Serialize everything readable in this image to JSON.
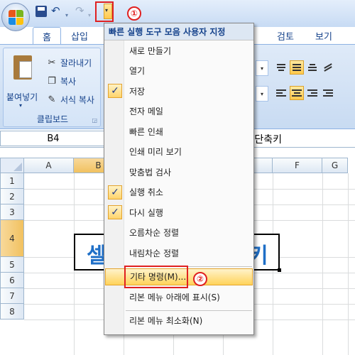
{
  "qat": {
    "customize_caret": "▾",
    "undo_glyph": "↶",
    "redo_glyph": "↷",
    "dropdown_glyph": "▾"
  },
  "callouts": {
    "first": "①",
    "second": "②"
  },
  "tabs": {
    "home": "홈",
    "insert": "삽입",
    "review": "검토",
    "view": "보기"
  },
  "clipboard": {
    "paste": "붙여넣기",
    "paste_caret": "▾",
    "cut": "잘라내기",
    "copy": "복사",
    "format_painter": "서식 복사",
    "group_label": "클립보드",
    "launcher": "◲"
  },
  "formula_bar": {
    "name_box": "B4",
    "visible_text": "l 단축키"
  },
  "grid": {
    "columns": [
      "A",
      "B",
      "C",
      "D",
      "E",
      "F",
      "G"
    ],
    "rows": [
      "1",
      "2",
      "3",
      "4",
      "5",
      "6",
      "7",
      "8"
    ],
    "selected_column": "B",
    "selected_row": "4",
    "cell_left_text": "셀",
    "cell_right_text": "키"
  },
  "menu": {
    "header": "빠른 실행 도구 모음 사용자 지정",
    "items": [
      {
        "label": "새로 만들기",
        "checked": false
      },
      {
        "label": "열기",
        "checked": false
      },
      {
        "label": "저장",
        "checked": true
      },
      {
        "label": "전자 메일",
        "checked": false
      },
      {
        "label": "빠른 인쇄",
        "checked": false
      },
      {
        "label": "인쇄 미리 보기",
        "checked": false
      },
      {
        "label": "맞춤법 검사",
        "checked": false
      },
      {
        "label": "실행 취소",
        "checked": true
      },
      {
        "label": "다시 실행",
        "checked": true
      },
      {
        "label": "오름차순 정렬",
        "checked": false
      },
      {
        "label": "내림차순 정렬",
        "checked": false
      },
      {
        "label": "기타 명령(M)...",
        "checked": false
      },
      {
        "label": "리본 메뉴 아래에 표시(S)",
        "checked": false
      },
      {
        "label": "리본 메뉴 최소화(N)",
        "checked": false
      }
    ],
    "check_glyph": "✓"
  },
  "colors": {
    "accent": "#15428b",
    "highlight": "#e02020",
    "hover": "#ffd35a",
    "cell_text": "#1f6fc7"
  }
}
